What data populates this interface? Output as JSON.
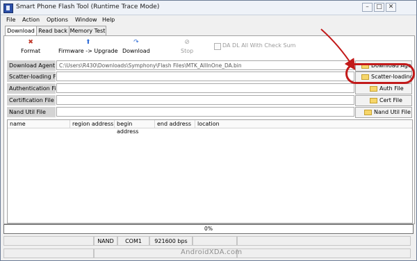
{
  "window": {
    "title": "Smart Phone Flash Tool (Runtime Trace Mode)",
    "controls": [
      "–",
      "□",
      "✕"
    ]
  },
  "menu": [
    "File",
    "Action",
    "Options",
    "Window",
    "Help"
  ],
  "tabs": [
    {
      "label": "Download",
      "active": true
    },
    {
      "label": "Read back",
      "active": false
    },
    {
      "label": "Memory Test",
      "active": false
    }
  ],
  "toolbar": {
    "format": {
      "label": "Format",
      "icon": "format-icon"
    },
    "upgrade": {
      "label": "Firmware -> Upgrade",
      "icon": "upgrade-icon"
    },
    "download": {
      "label": "Download",
      "icon": "download-icon"
    },
    "stop": {
      "label": "Stop",
      "icon": "stop-icon"
    },
    "da_checkbox": {
      "label": "DA DL All With Check Sum",
      "checked": false
    }
  },
  "files": {
    "download_agent": {
      "label": "Download Agent",
      "value": "C:\\Users\\R430\\Downloads\\Symphony\\Flash Files\\MTK_AllInOne_DA.bin",
      "button": "Download Agent"
    },
    "scatter": {
      "label": "Scatter-loading File",
      "value": "",
      "button": "Scatter-loading"
    },
    "auth": {
      "label": "Authentication File",
      "value": "",
      "button": "Auth File"
    },
    "cert": {
      "label": "Certification File",
      "value": "",
      "button": "Cert File"
    },
    "nand": {
      "label": "Nand Util File",
      "value": "",
      "button": "Nand Util File"
    }
  },
  "table": {
    "columns": [
      "name",
      "region address",
      "begin address",
      "end address",
      "location"
    ],
    "rows": []
  },
  "progress": {
    "text": "0%",
    "value": 0
  },
  "status": {
    "storage": "NAND",
    "port": "COM1",
    "baud": "921600 bps"
  },
  "watermark": "AndroidXDA.com",
  "colors": {
    "annotation": "#c21a1a",
    "label_bg": "#d4d4d4"
  }
}
